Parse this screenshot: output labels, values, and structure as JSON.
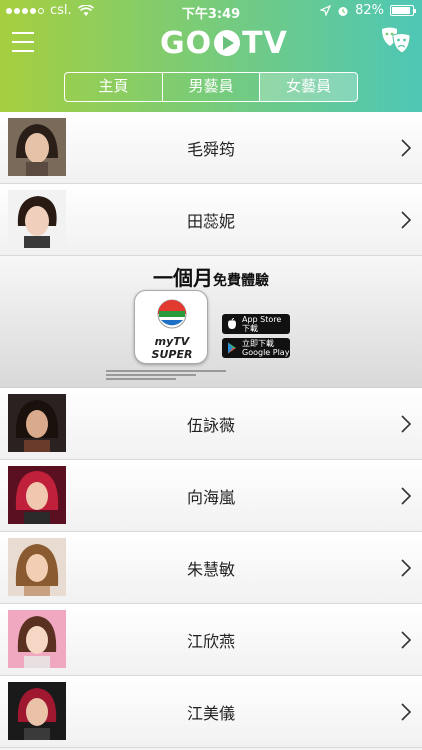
{
  "status": {
    "carrier": "csl.",
    "time": "下午3:49",
    "battery": "82%",
    "battery_level": 0.82
  },
  "header": {
    "logo": "GOTV"
  },
  "tabs": [
    {
      "label": "主頁"
    },
    {
      "label": "男藝員"
    },
    {
      "label": "女藝員"
    }
  ],
  "active_tab": 2,
  "artists_top": [
    {
      "name": "毛舜筠"
    },
    {
      "name": "田蕊妮"
    }
  ],
  "ad": {
    "headline_big": "一個月",
    "headline_small": "免費體驗",
    "app_name": "myTV SUPER",
    "appstore_line1": "App Store",
    "appstore_line2": "下載",
    "google_line1": "立即下載",
    "google_line2": "Google Play"
  },
  "artists_bottom": [
    {
      "name": "伍詠薇"
    },
    {
      "name": "向海嵐"
    },
    {
      "name": "朱慧敏"
    },
    {
      "name": "江欣燕"
    },
    {
      "name": "江美儀"
    }
  ],
  "colors": {
    "gradient_start": "#a6cf3f",
    "gradient_end": "#4ec7b6"
  }
}
